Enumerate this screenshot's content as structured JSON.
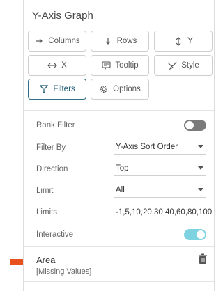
{
  "panel": {
    "title": "Y-Axis Graph"
  },
  "buttons": {
    "columns": "Columns",
    "rows": "Rows",
    "y": "Y",
    "x": "X",
    "tooltip": "Tooltip",
    "style": "Style",
    "filters": "Filters",
    "options": "Options"
  },
  "filters": {
    "rank_filter_label": "Rank Filter",
    "rank_filter_on": false,
    "filter_by_label": "Filter By",
    "filter_by_value": "Y-Axis Sort Order",
    "direction_label": "Direction",
    "direction_value": "Top",
    "limit_label": "Limit",
    "limit_value": "All",
    "limits_label": "Limits",
    "limits_value": "-1,5,10,20,30,40,60,80,100",
    "interactive_label": "Interactive",
    "interactive_on": true
  },
  "area": {
    "title": "Area",
    "subtitle": "[Missing Values]"
  },
  "colors": {
    "accent": "#2f6f86",
    "toggle_on": "#7fd3e0",
    "toggle_off": "#7a7a7a",
    "pointer_arrow": "#e8501e"
  },
  "icons": {
    "columns": "arrow-right-icon",
    "rows": "arrow-down-icon",
    "y": "vertical-arrows-icon",
    "x": "horizontal-arrows-icon",
    "tooltip": "tooltip-icon",
    "style": "brush-icon",
    "filters": "filter-icon",
    "options": "gear-icon",
    "delete": "trash-icon"
  }
}
